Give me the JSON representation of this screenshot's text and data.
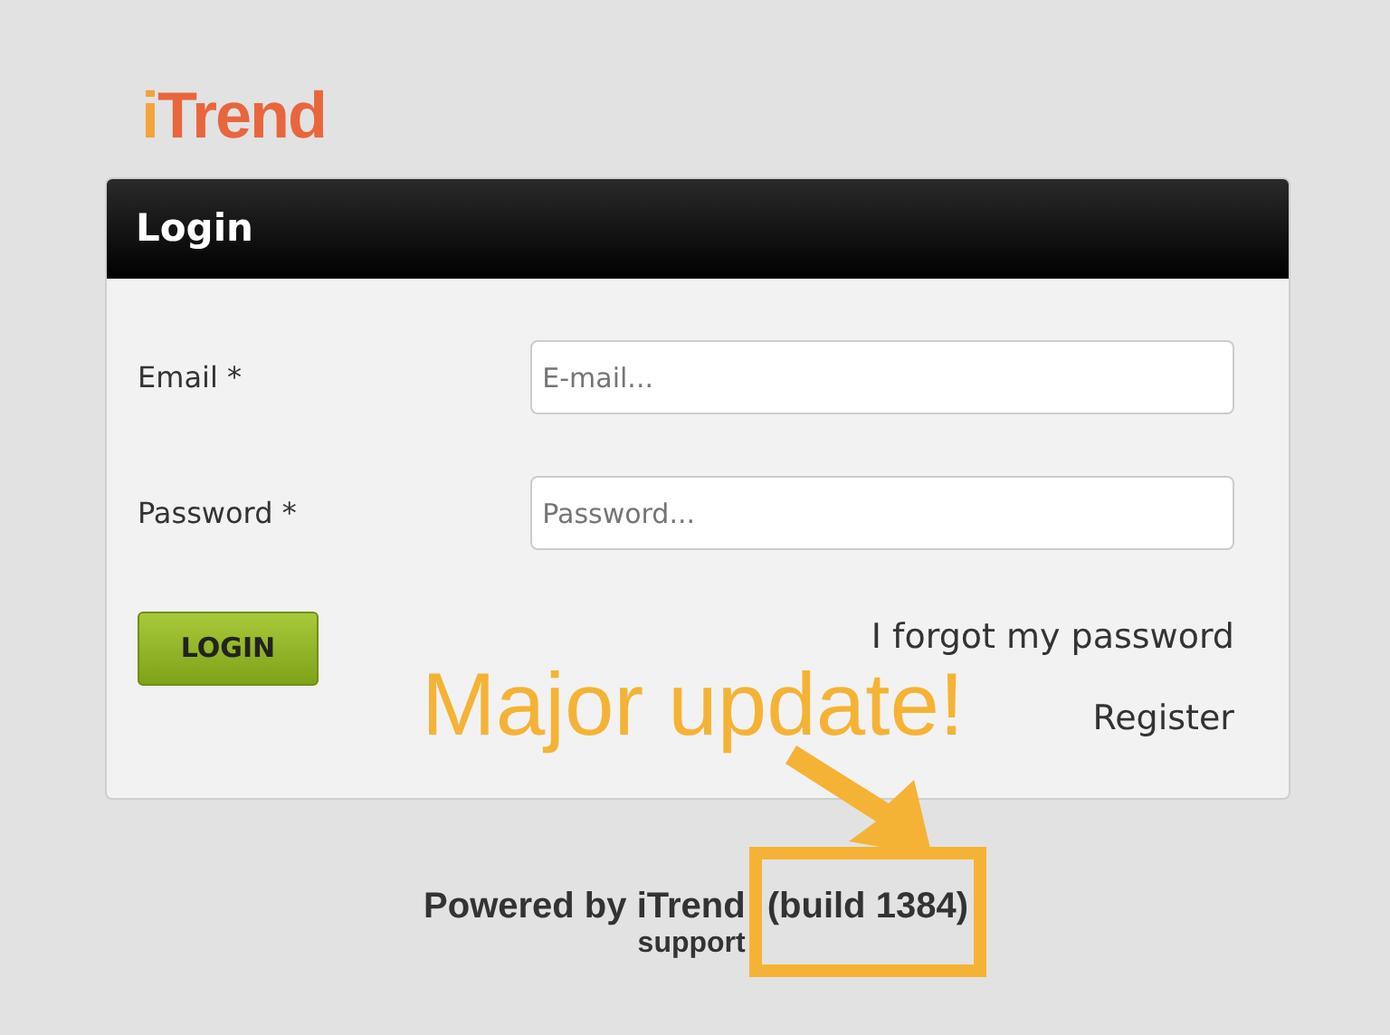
{
  "logo": {
    "text": "iTrend"
  },
  "login_panel": {
    "title": "Login",
    "fields": [
      {
        "label": "Email *",
        "placeholder": "E-mail..."
      },
      {
        "label": "Password *",
        "placeholder": "Password..."
      }
    ],
    "login_button": "LOGIN",
    "links": [
      "I forgot my password",
      "Register"
    ]
  },
  "annotation": {
    "text": "Major update!"
  },
  "footer": {
    "powered_by": "Powered by iTrend",
    "build": "(build 1384)",
    "support": "support"
  }
}
